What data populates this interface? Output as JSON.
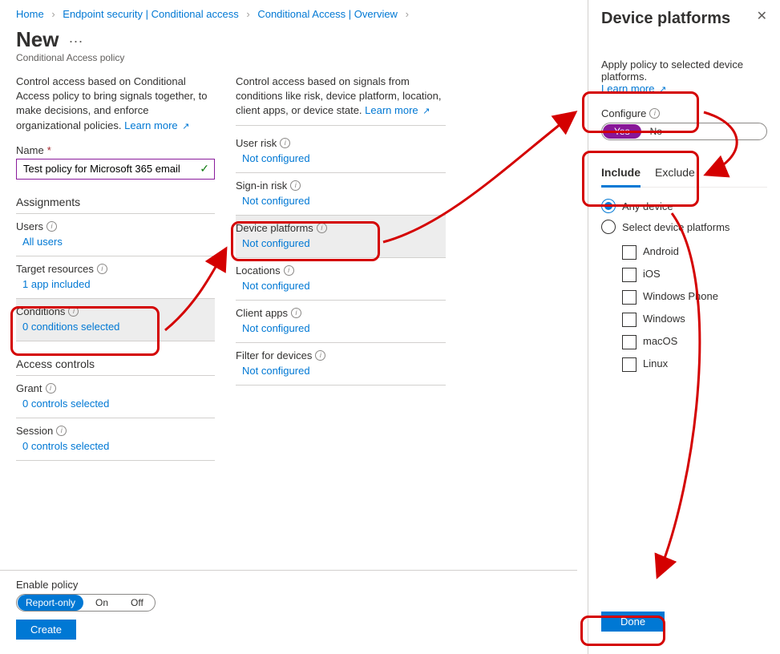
{
  "breadcrumbs": {
    "items": [
      "Home",
      "Endpoint security | Conditional access",
      "Conditional Access | Overview"
    ]
  },
  "page": {
    "title": "New",
    "subtitle": "Conditional Access policy"
  },
  "col1": {
    "desc": "Control access based on Conditional Access policy to bring signals together, to make decisions, and enforce organizational policies.",
    "learn_more": "Learn more",
    "name_label": "Name",
    "name_value": "Test policy for Microsoft 365 email",
    "assignments_heading": "Assignments",
    "users": {
      "label": "Users",
      "value": "All users"
    },
    "target": {
      "label": "Target resources",
      "value": "1 app included"
    },
    "conditions": {
      "label": "Conditions",
      "value": "0 conditions selected"
    },
    "access_heading": "Access controls",
    "grant": {
      "label": "Grant",
      "value": "0 controls selected"
    },
    "session": {
      "label": "Session",
      "value": "0 controls selected"
    }
  },
  "col2": {
    "desc": "Control access based on signals from conditions like risk, device platform, location, client apps, or device state.",
    "learn_more": "Learn more",
    "user_risk": {
      "label": "User risk",
      "value": "Not configured"
    },
    "signin_risk": {
      "label": "Sign-in risk",
      "value": "Not configured"
    },
    "device_platforms": {
      "label": "Device platforms",
      "value": "Not configured"
    },
    "locations": {
      "label": "Locations",
      "value": "Not configured"
    },
    "client_apps": {
      "label": "Client apps",
      "value": "Not configured"
    },
    "filter_devices": {
      "label": "Filter for devices",
      "value": "Not configured"
    }
  },
  "panel": {
    "title": "Device platforms",
    "desc": "Apply policy to selected device platforms.",
    "learn_more": "Learn more",
    "configure_label": "Configure",
    "toggle": {
      "yes": "Yes",
      "no": "No"
    },
    "tabs": {
      "include": "Include",
      "exclude": "Exclude"
    },
    "radio_any": "Any device",
    "radio_select": "Select device platforms",
    "platforms": [
      "Android",
      "iOS",
      "Windows Phone",
      "Windows",
      "macOS",
      "Linux"
    ],
    "done": "Done"
  },
  "footer": {
    "enable_label": "Enable policy",
    "options": {
      "report": "Report-only",
      "on": "On",
      "off": "Off"
    },
    "create": "Create"
  }
}
